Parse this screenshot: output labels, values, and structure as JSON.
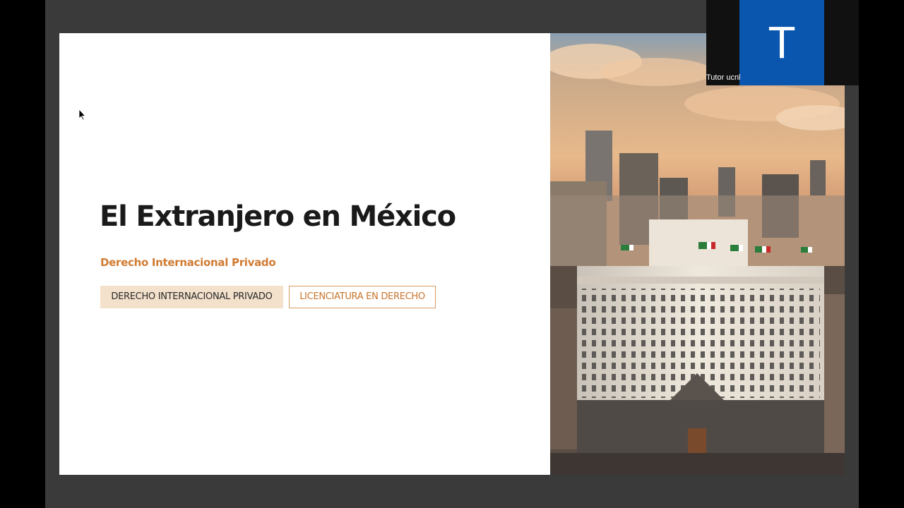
{
  "slide": {
    "title": "El Extranjero en México",
    "subtitle": "Derecho Internacional Privado",
    "tags": [
      "DERECHO INTERNACIONAL PRIVADO",
      "LICENCIATURA EN DERECHO"
    ],
    "photo_icon": "mexico-city-skyline-photo"
  },
  "participant": {
    "initial": "T",
    "name": "Tutor ucnl"
  },
  "colors": {
    "accent": "#d07b32",
    "tag_fill": "#f4e1cc",
    "avatar": "#0a56ae"
  },
  "cursor_icon": "mouse-pointer-icon"
}
